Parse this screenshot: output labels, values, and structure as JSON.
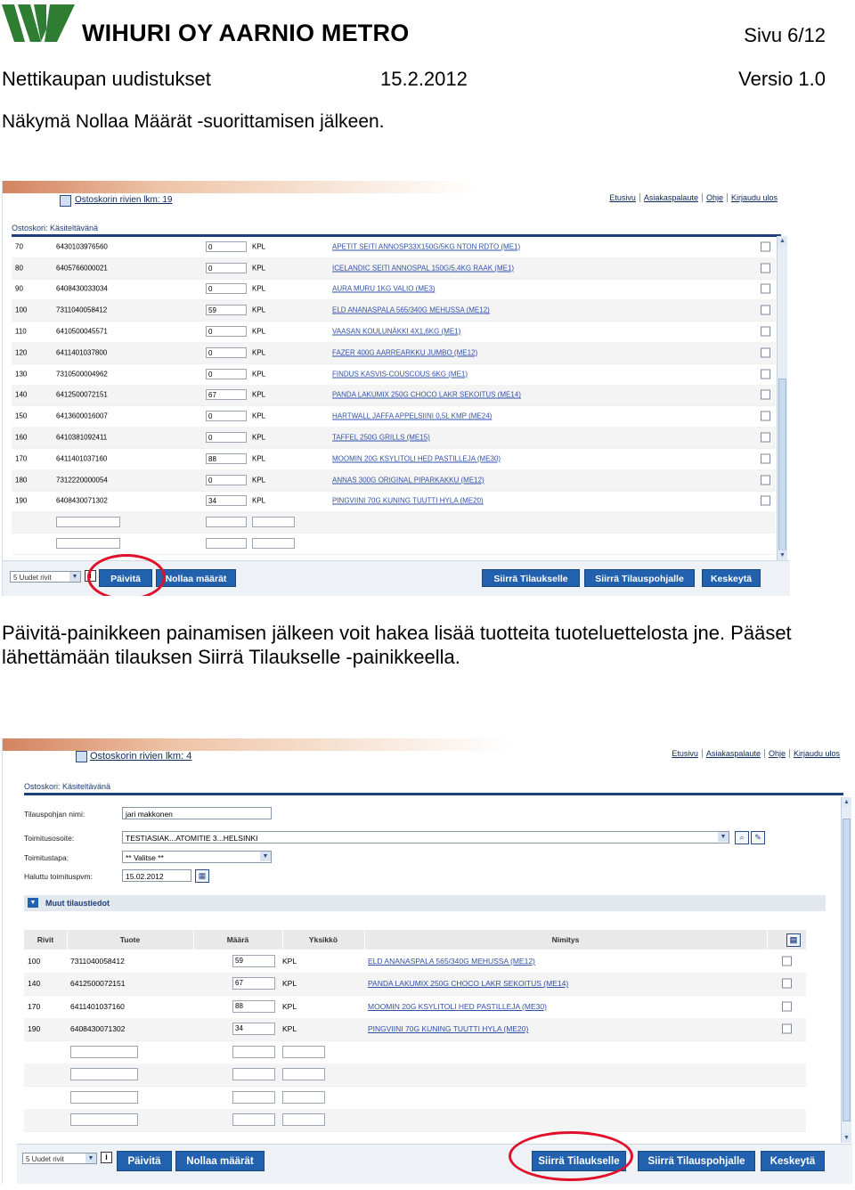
{
  "header": {
    "company": "WIHURI OY AARNIO METRO",
    "page": "Sivu 6/12",
    "doc_title": "Nettikaupan uudistukset",
    "date": "15.2.2012",
    "version": "Versio 1.0"
  },
  "caption1": "Näkymä Nollaa Määrät -suorittamisen jälkeen.",
  "paragraph": "Päivitä-painikkeen painamisen jälkeen voit hakea lisää tuotteita tuoteluettelosta jne. Pääset lähettämään tilauksen Siirrä Tilaukselle -painikkeella.",
  "colors": {
    "button_blue": "#2161ad",
    "highlight_red": "#e0102a",
    "logo_green": "#2f7d32"
  },
  "shot1": {
    "cart_title": "Ostoskorin rivien lkm: 19",
    "links": [
      "Etusivu",
      "Asiakaspalaute",
      "Ohje",
      "Kirjaudu ulos"
    ],
    "section": "Ostoskori: Käsiteltävänä",
    "rows": [
      {
        "row": "70",
        "code": "6430103976560",
        "qty": "0",
        "unit": "KPL",
        "name": "APETIT SEITI ANNOSP33X150G/5KG NTON RDTO (ME1)"
      },
      {
        "row": "80",
        "code": "6405766000021",
        "qty": "0",
        "unit": "KPL",
        "name": "ICELANDIC SEITI ANNOSPAL 150G/5,4KG RAAK (ME1)"
      },
      {
        "row": "90",
        "code": "6408430033034",
        "qty": "0",
        "unit": "KPL",
        "name": "AURA MURU 1KG VALIO (ME3)"
      },
      {
        "row": "100",
        "code": "7311040058412",
        "qty": "59",
        "unit": "KPL",
        "name": "ELD ANANASPALA 565/340G MEHUSSA (ME12)"
      },
      {
        "row": "110",
        "code": "6410500045571",
        "qty": "0",
        "unit": "KPL",
        "name": "VAASAN KOULUNÄKKI 4X1,6KG (ME1)"
      },
      {
        "row": "120",
        "code": "6411401037800",
        "qty": "0",
        "unit": "KPL",
        "name": "FAZER 400G AARREARKKU JUMBO (ME12)"
      },
      {
        "row": "130",
        "code": "7310500004962",
        "qty": "0",
        "unit": "KPL",
        "name": "FINDUS KASVIS-COUSCOUS 6KG (ME1)"
      },
      {
        "row": "140",
        "code": "6412500072151",
        "qty": "67",
        "unit": "KPL",
        "name": "PANDA LAKUMIX 250G CHOCO LAKR SEKOITUS (ME14)"
      },
      {
        "row": "150",
        "code": "6413600016007",
        "qty": "0",
        "unit": "KPL",
        "name": "HARTWALL JAFFA APPELSIINI 0,5L KMP (ME24)"
      },
      {
        "row": "160",
        "code": "6410381092411",
        "qty": "0",
        "unit": "KPL",
        "name": "TAFFEL 250G GRILLS (ME15)"
      },
      {
        "row": "170",
        "code": "6411401037160",
        "qty": "88",
        "unit": "KPL",
        "name": "MOOMIN 20G KSYLITOLI HED PASTILLEJA (ME30)"
      },
      {
        "row": "180",
        "code": "7312220000054",
        "qty": "0",
        "unit": "KPL",
        "name": "ANNAS 300G ORIGINAL PIPARKAKKU (ME12)"
      },
      {
        "row": "190",
        "code": "6408430071302",
        "qty": "34",
        "unit": "KPL",
        "name": "PINGVIINI 70G KUNING TUUTTI HYLA (ME20)"
      }
    ],
    "new_rows_select": "5 Uudet rivit",
    "buttons": {
      "update": "Päivitä",
      "reset": "Nollaa määrät",
      "to_order": "Siirrä Tilaukselle",
      "to_template": "Siirrä Tilauspohjalle",
      "cancel": "Keskeytä"
    }
  },
  "shot2": {
    "cart_title": "Ostoskorin rivien lkm: 4",
    "links": [
      "Etusivu",
      "Asiakaspalaute",
      "Ohje",
      "Kirjaudu ulos"
    ],
    "section": "Ostoskori: Käsiteltävänä",
    "form": {
      "template_label": "Tilauspohjan nimi:",
      "template_value": "jari makkonen",
      "site_label": "Toimitusosoite:",
      "site_value": "TESTIASIAK...ATOMITIE 3...HELSINKI",
      "method_label": "Toimitustapa:",
      "method_value": "** Valitse **",
      "date_label": "Haluttu toimituspvm:",
      "date_value": "15.02.2012"
    },
    "other_details": "Muut tilaustiedot",
    "columns": [
      "Rivit",
      "Tuote",
      "Määrä",
      "Yksikkö",
      "Nimitys"
    ],
    "rows": [
      {
        "row": "100",
        "code": "7311040058412",
        "qty": "59",
        "unit": "KPL",
        "name": "ELD ANANASPALA 565/340G MEHUSSA (ME12)"
      },
      {
        "row": "140",
        "code": "6412500072151",
        "qty": "67",
        "unit": "KPL",
        "name": "PANDA LAKUMIX 250G CHOCO LAKR SEKOITUS (ME14)"
      },
      {
        "row": "170",
        "code": "6411401037160",
        "qty": "88",
        "unit": "KPL",
        "name": "MOOMIN 20G KSYLITOLI HED PASTILLEJA (ME30)"
      },
      {
        "row": "190",
        "code": "6408430071302",
        "qty": "34",
        "unit": "KPL",
        "name": "PINGVIINI 70G KUNING TUUTTI HYLA (ME20)"
      }
    ],
    "new_rows_select": "5 Uudet rivit",
    "buttons": {
      "update": "Päivitä",
      "reset": "Nollaa määrät",
      "to_order": "Siirrä Tilaukselle",
      "to_template": "Siirrä Tilauspohjalle",
      "cancel": "Keskeytä"
    }
  }
}
